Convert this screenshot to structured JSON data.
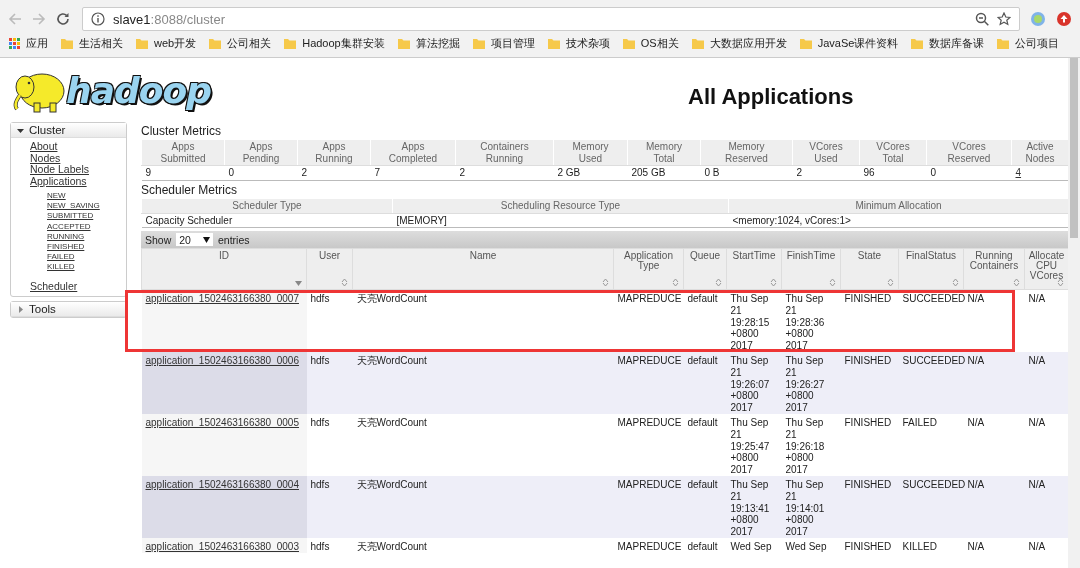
{
  "browser": {
    "url_host": "slave1",
    "url_path": ":8088/cluster",
    "bookmarks": [
      {
        "label": "应用",
        "kind": "apps"
      },
      {
        "label": "生活相关",
        "kind": "folder"
      },
      {
        "label": "web开发",
        "kind": "folder"
      },
      {
        "label": "公司相关",
        "kind": "folder"
      },
      {
        "label": "Hadoop集群安装",
        "kind": "folder"
      },
      {
        "label": "算法挖掘",
        "kind": "folder"
      },
      {
        "label": "项目管理",
        "kind": "folder"
      },
      {
        "label": "技术杂项",
        "kind": "folder"
      },
      {
        "label": "OS相关",
        "kind": "folder"
      },
      {
        "label": "大数据应用开发",
        "kind": "folder"
      },
      {
        "label": "JavaSe课件资料",
        "kind": "folder"
      },
      {
        "label": "数据库备课",
        "kind": "folder"
      },
      {
        "label": "公司项目",
        "kind": "folder"
      }
    ]
  },
  "logo_text": "hadoop",
  "page_title": "All Applications",
  "sidebar": [
    {
      "label": "Cluster",
      "expanded": true,
      "items": [
        {
          "label": "About"
        },
        {
          "label": "Nodes"
        },
        {
          "label": "Node Labels"
        },
        {
          "label": "Applications",
          "children": [
            {
              "label": "NEW"
            },
            {
              "label": "NEW_SAVING"
            },
            {
              "label": "SUBMITTED"
            },
            {
              "label": "ACCEPTED"
            },
            {
              "label": "RUNNING"
            },
            {
              "label": "FINISHED"
            },
            {
              "label": "FAILED"
            },
            {
              "label": "KILLED"
            }
          ]
        },
        {
          "label": "Scheduler"
        }
      ]
    },
    {
      "label": "Tools",
      "expanded": false
    }
  ],
  "cluster_metrics": {
    "title": "Cluster Metrics",
    "columns": [
      "Apps Submitted",
      "Apps Pending",
      "Apps Running",
      "Apps Completed",
      "Containers Running",
      "Memory Used",
      "Memory Total",
      "Memory Reserved",
      "VCores Used",
      "VCores Total",
      "VCores Reserved",
      "Active Nodes"
    ],
    "values": [
      {
        "text": "9",
        "link": false
      },
      {
        "text": "0",
        "link": false
      },
      {
        "text": "2",
        "link": false
      },
      {
        "text": "7",
        "link": false
      },
      {
        "text": "2",
        "link": false
      },
      {
        "text": "2 GB",
        "link": false
      },
      {
        "text": "205 GB",
        "link": false
      },
      {
        "text": "0 B",
        "link": false
      },
      {
        "text": "2",
        "link": false
      },
      {
        "text": "96",
        "link": false
      },
      {
        "text": "0",
        "link": false
      },
      {
        "text": "4",
        "link": true
      }
    ]
  },
  "scheduler_metrics": {
    "title": "Scheduler Metrics",
    "columns": [
      "Scheduler Type",
      "Scheduling Resource Type",
      "Minimum Allocation"
    ],
    "values": [
      "Capacity Scheduler",
      "[MEMORY]",
      "<memory:1024, vCores:1>"
    ]
  },
  "apps_table": {
    "show_label": "Show",
    "page_size": "20",
    "entries_label": "entries",
    "columns": [
      {
        "label": "ID",
        "sorted": true
      },
      {
        "label": "User",
        "sorted": false
      },
      {
        "label": "Name",
        "sorted": false
      },
      {
        "label": "Application Type",
        "sorted": false
      },
      {
        "label": "Queue",
        "sorted": false
      },
      {
        "label": "StartTime",
        "sorted": false
      },
      {
        "label": "FinishTime",
        "sorted": false
      },
      {
        "label": "State",
        "sorted": false
      },
      {
        "label": "FinalStatus",
        "sorted": false
      },
      {
        "label": "Running Containers",
        "sorted": false
      },
      {
        "label": "Allocate CPU VCores",
        "sorted": false
      }
    ],
    "rows": [
      {
        "highlighted": true,
        "cells": [
          "application_1502463166380_0007",
          "hdfs",
          "天亮WordCount",
          "MAPREDUCE",
          "default",
          "Thu Sep 21 19:28:15 +0800 2017",
          "Thu Sep 21 19:28:36 +0800 2017",
          "FINISHED",
          "SUCCEEDED",
          "N/A",
          "N/A"
        ]
      },
      {
        "highlighted": false,
        "cells": [
          "application_1502463166380_0006",
          "hdfs",
          "天亮WordCount",
          "MAPREDUCE",
          "default",
          "Thu Sep 21 19:26:07 +0800 2017",
          "Thu Sep 21 19:26:27 +0800 2017",
          "FINISHED",
          "SUCCEEDED",
          "N/A",
          "N/A"
        ]
      },
      {
        "highlighted": false,
        "cells": [
          "application_1502463166380_0005",
          "hdfs",
          "天亮WordCount",
          "MAPREDUCE",
          "default",
          "Thu Sep 21 19:25:47 +0800 2017",
          "Thu Sep 21 19:26:18 +0800 2017",
          "FINISHED",
          "FAILED",
          "N/A",
          "N/A"
        ]
      },
      {
        "highlighted": false,
        "cells": [
          "application_1502463166380_0004",
          "hdfs",
          "天亮WordCount",
          "MAPREDUCE",
          "default",
          "Thu Sep 21 19:13:41 +0800 2017",
          "Thu Sep 21 19:14:01 +0800 2017",
          "FINISHED",
          "SUCCEEDED",
          "N/A",
          "N/A"
        ]
      },
      {
        "highlighted": false,
        "cells": [
          "application_1502463166380_0003",
          "hdfs",
          "天亮WordCount",
          "MAPREDUCE",
          "default",
          "Wed Sep",
          "Wed Sep",
          "FINISHED",
          "KILLED",
          "N/A",
          "N/A"
        ]
      }
    ]
  }
}
